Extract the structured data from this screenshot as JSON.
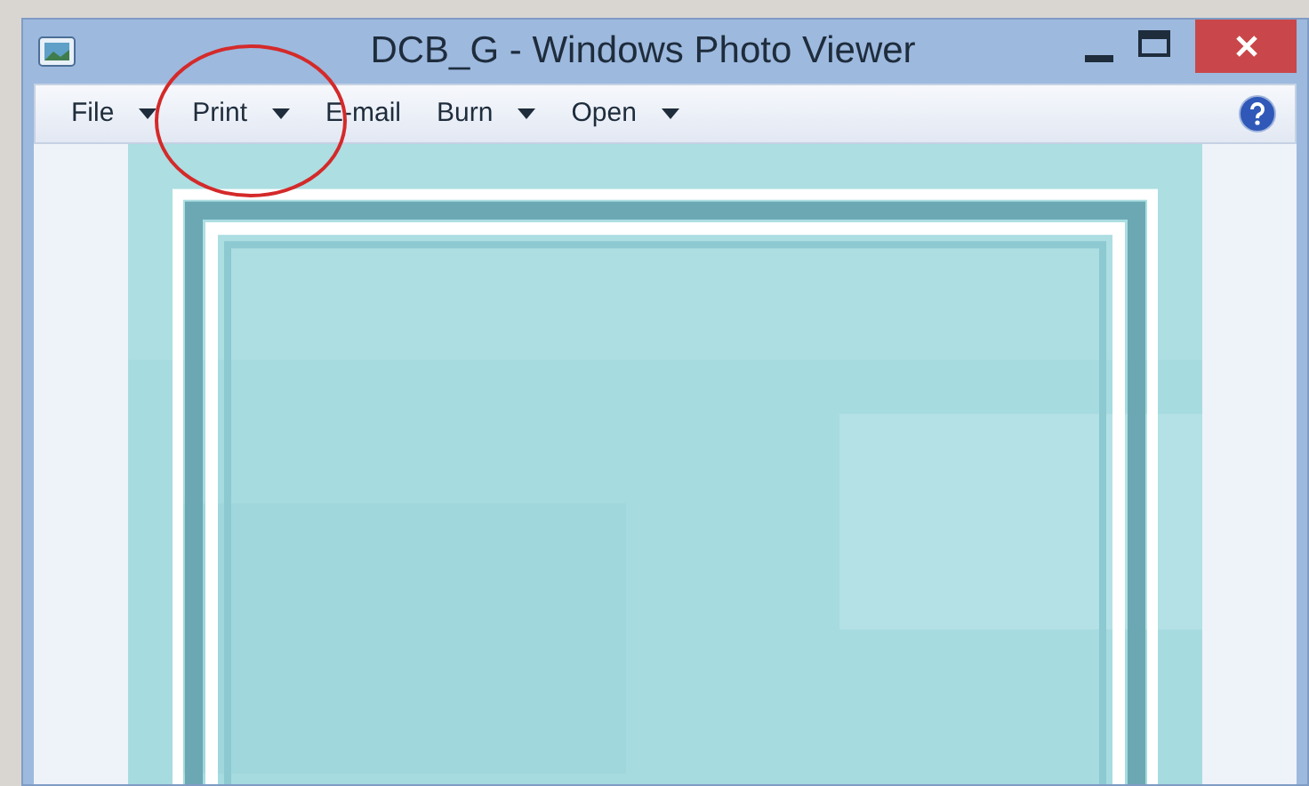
{
  "window": {
    "title": "DCB_G - Windows Photo Viewer"
  },
  "menu": [
    {
      "label": "File",
      "kind": "dropdown"
    },
    {
      "label": "Print",
      "kind": "dropdown"
    },
    {
      "label": "E-mail",
      "kind": "button"
    },
    {
      "label": "Burn",
      "kind": "dropdown"
    },
    {
      "label": "Open",
      "kind": "dropdown"
    }
  ]
}
